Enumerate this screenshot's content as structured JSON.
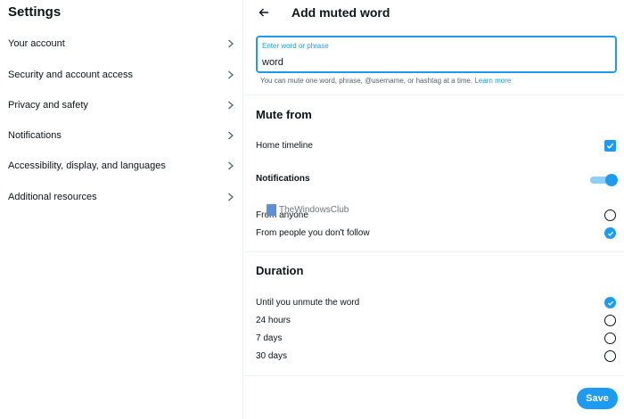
{
  "sidebar": {
    "title": "Settings",
    "items": [
      {
        "label": "Your account"
      },
      {
        "label": "Security and account access"
      },
      {
        "label": "Privacy and safety"
      },
      {
        "label": "Notifications"
      },
      {
        "label": "Accessibility, display, and languages"
      },
      {
        "label": "Additional resources"
      }
    ]
  },
  "main": {
    "title": "Add muted word",
    "input": {
      "label": "Enter word or phrase",
      "value": "word"
    },
    "hint": {
      "text": "You can mute one word, phrase, @username, or hashtag at a time.",
      "link": "Learn more"
    },
    "mute_from": {
      "title": "Mute from",
      "home_timeline": {
        "label": "Home timeline",
        "checked": true
      },
      "notifications": {
        "label": "Notifications",
        "enabled": true
      },
      "options": [
        {
          "label": "From anyone",
          "checked": false
        },
        {
          "label": "From people you don't follow",
          "checked": true
        }
      ]
    },
    "duration": {
      "title": "Duration",
      "options": [
        {
          "label": "Until you unmute the word",
          "checked": true
        },
        {
          "label": "24 hours",
          "checked": false
        },
        {
          "label": "7 days",
          "checked": false
        },
        {
          "label": "30 days",
          "checked": false
        }
      ]
    },
    "save_label": "Save"
  },
  "watermark": {
    "text": "TheWindowsClub"
  },
  "colors": {
    "accent": "#1d9bf0",
    "toggle_track": "#8ecdf8",
    "text": "#0f1419",
    "muted_text": "#536471",
    "divider": "#eff3f4"
  }
}
